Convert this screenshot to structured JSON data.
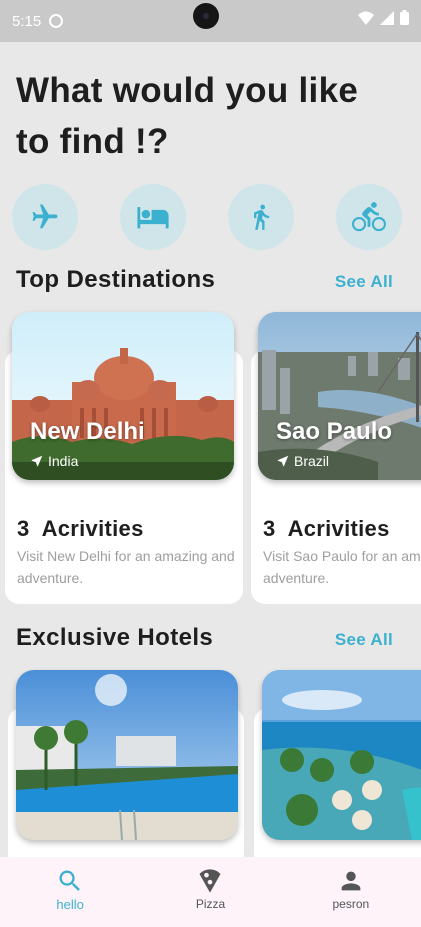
{
  "status_bar": {
    "time": "5:15"
  },
  "header": {
    "title": "What would you like to find !?"
  },
  "categories": [
    {
      "icon": "airplane-icon"
    },
    {
      "icon": "bed-icon"
    },
    {
      "icon": "walking-icon"
    },
    {
      "icon": "bicycle-icon"
    }
  ],
  "top_destinations": {
    "title": "Top Destinations",
    "see_all": "See All",
    "cards": [
      {
        "city": "New Delhi",
        "country": "India",
        "activities_count": "3",
        "activities_label": "Acrivities",
        "description": "Visit New Delhi for an amazing and adventure."
      },
      {
        "city": "Sao Paulo",
        "country": "Brazil",
        "activities_count": "3",
        "activities_label": "Acrivities",
        "description": "Visit Sao Paulo for an amazing and adventure."
      }
    ]
  },
  "exclusive_hotels": {
    "title": "Exclusive Hotels",
    "see_all": "See All"
  },
  "bottom_nav": [
    {
      "label": "hello",
      "icon": "search-icon",
      "active": true
    },
    {
      "label": "Pizza",
      "icon": "pizza-icon",
      "active": false
    },
    {
      "label": "pesron",
      "icon": "person-icon",
      "active": false
    }
  ],
  "colors": {
    "accent": "#3cb1cf",
    "icon_bg": "#cfe5ea"
  }
}
